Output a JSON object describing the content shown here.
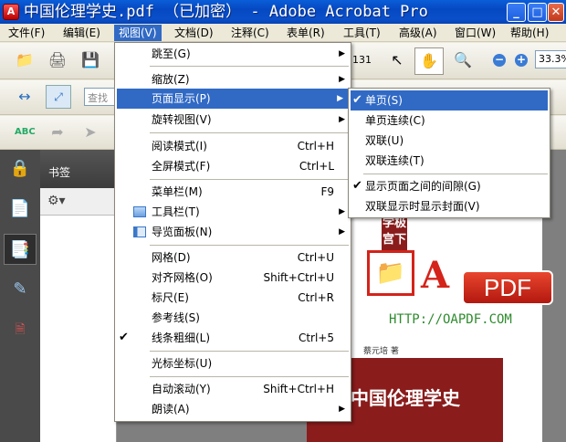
{
  "window": {
    "app_icon": "acrobat-icon",
    "title": "中国伦理学史.pdf （已加密） - Adobe Acrobat Pro",
    "min_glyph": "_",
    "max_glyph": "□",
    "close_glyph": "✕"
  },
  "menubar": [
    "文件(F)",
    "编辑(E)",
    "视图(V)",
    "文档(D)",
    "注释(C)",
    "表单(R)",
    "工具(T)",
    "高级(A)",
    "窗口(W)",
    "帮助(H)"
  ],
  "toolbar": {
    "page_number": "131",
    "zoom": "33.3%",
    "search_placeholder": "查找"
  },
  "side_panel": {
    "title": "书签"
  },
  "view_menu": {
    "items": [
      {
        "label": "跳至(G)",
        "submenu": true
      },
      {
        "label": "缩放(Z)",
        "submenu": true
      },
      {
        "label": "页面显示(P)",
        "submenu": true,
        "highlighted": true
      },
      {
        "label": "旋转视图(V)",
        "submenu": true
      },
      {
        "label": "阅读模式(I)",
        "shortcut": "Ctrl+H"
      },
      {
        "label": "全屏模式(F)",
        "shortcut": "Ctrl+L"
      },
      {
        "label": "菜单栏(M)",
        "shortcut": "F9"
      },
      {
        "label": "工具栏(T)",
        "submenu": true
      },
      {
        "label": "导览面板(N)",
        "submenu": true
      },
      {
        "label": "网格(D)",
        "shortcut": "Ctrl+U"
      },
      {
        "label": "对齐网格(O)",
        "shortcut": "Shift+Ctrl+U"
      },
      {
        "label": "标尺(E)",
        "shortcut": "Ctrl+R"
      },
      {
        "label": "参考线(S)"
      },
      {
        "label": "线条粗细(L)",
        "shortcut": "Ctrl+5",
        "checked": true
      },
      {
        "label": "光标坐标(U)"
      },
      {
        "label": "自动滚动(Y)",
        "shortcut": "Shift+Ctrl+H"
      },
      {
        "label": "朗读(A)",
        "submenu": true
      }
    ]
  },
  "page_display_submenu": {
    "items": [
      {
        "label": "单页(S)",
        "checked": true,
        "highlighted": true
      },
      {
        "label": "单页连续(C)"
      },
      {
        "label": "双联(U)"
      },
      {
        "label": "双联连续(T)"
      },
      {
        "label": "显示页面之间的间隙(G)",
        "checked": true
      },
      {
        "label": "双联显示时显示封面(V)"
      }
    ]
  },
  "document": {
    "title_fragment": "学极\n宫下",
    "logo_letter": "A",
    "logo_text": "PDF",
    "url": "HTTP://OAPDF.COM",
    "author": "蔡元培 著",
    "book_title": "中国伦理学史"
  },
  "colors": {
    "menu_highlight": "#316ac5",
    "title_bar": "#0548c2",
    "book_red": "#8a1c1c",
    "pdf_red": "#d4231a",
    "url_green": "#2e8b2e"
  }
}
